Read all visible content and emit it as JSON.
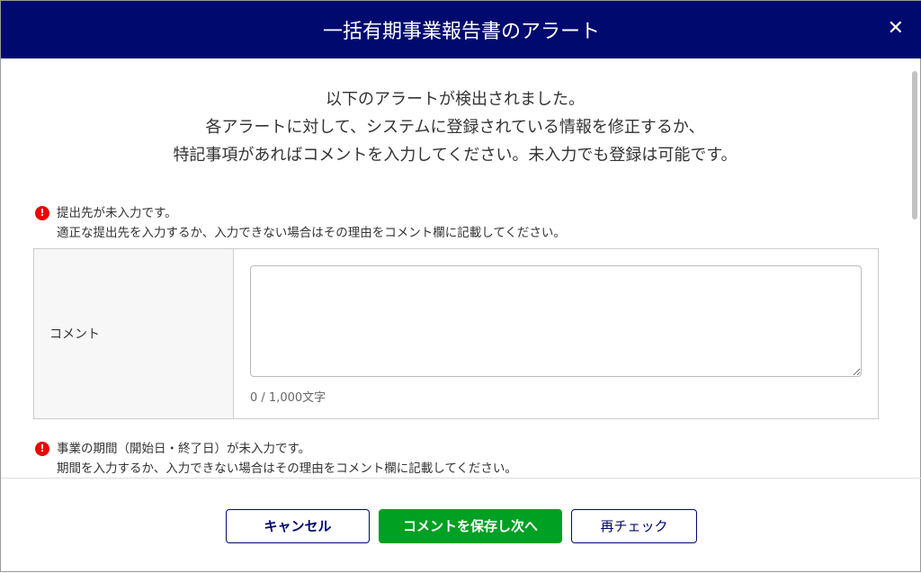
{
  "header": {
    "title": "一括有期事業報告書のアラート",
    "close": "✕"
  },
  "intro": [
    "以下のアラートが検出されました。",
    "各アラートに対して、システムに登録されている情報を修正するか、",
    "特記事項があればコメントを入力してください。未入力でも登録は可能です。"
  ],
  "alerts": [
    {
      "icon": "!",
      "title": "提出先が未入力です。",
      "detail": "適正な提出先を入力するか、入力できない場合はその理由をコメント欄に記載してください。",
      "comment_label": "コメント",
      "comment_value": "",
      "counter": "0 / 1,000文字"
    },
    {
      "icon": "!",
      "title": "事業の期間（開始日・終了日）が未入力です。",
      "detail": "期間を入力するか、入力できない場合はその理由をコメント欄に記載してください。"
    }
  ],
  "footer": {
    "cancel": "キャンセル",
    "save_next": "コメントを保存し次へ",
    "recheck": "再チェック"
  },
  "colors": {
    "header": "#000a6e",
    "primary": "#00a023",
    "alert": "#e00000"
  }
}
